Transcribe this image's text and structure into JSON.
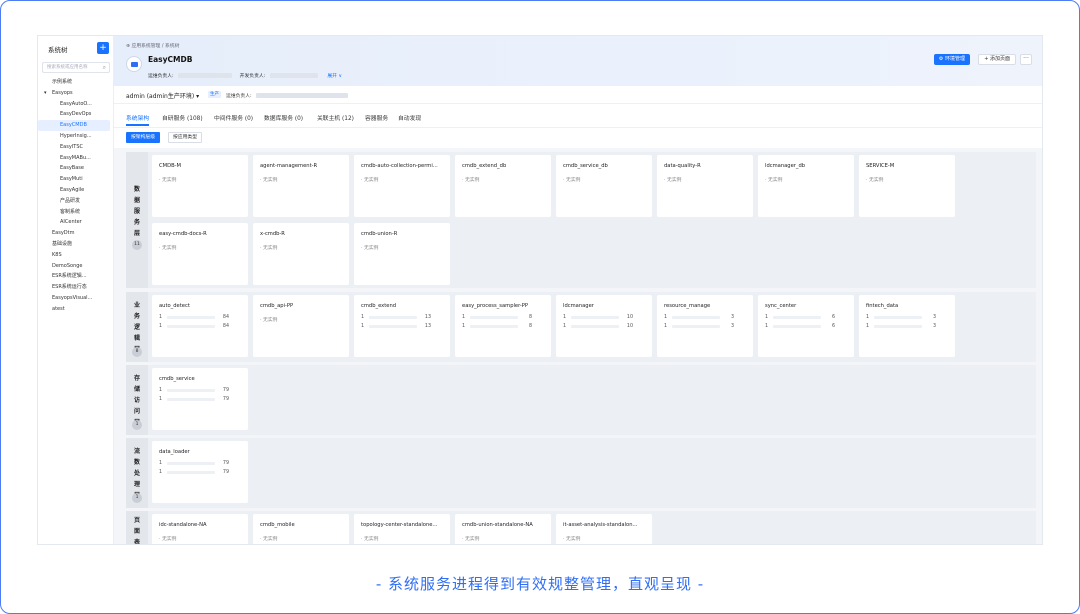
{
  "sidebar": {
    "title": "系统树",
    "add_label": "+",
    "search_placeholder": "搜索系统或应用名称",
    "items": [
      {
        "label": "示例系统",
        "indent": 1
      },
      {
        "label": "Easyops",
        "indent": 0,
        "caret": true
      },
      {
        "label": "EasyAutoO...",
        "indent": 2
      },
      {
        "label": "EasyDevOps",
        "indent": 2
      },
      {
        "label": "EasyCMDB",
        "indent": 2,
        "active": true
      },
      {
        "label": "HyperInsig...",
        "indent": 2
      },
      {
        "label": "EasyITSC",
        "indent": 2
      },
      {
        "label": "EasyMABu...",
        "indent": 2
      },
      {
        "label": "EasyBase",
        "indent": 2
      },
      {
        "label": "EasyMuti",
        "indent": 2
      },
      {
        "label": "EasyAgile",
        "indent": 2
      },
      {
        "label": "产品研发",
        "indent": 2
      },
      {
        "label": "客制系统",
        "indent": 2
      },
      {
        "label": "AICenter",
        "indent": 2
      },
      {
        "label": "EasyDtm",
        "indent": 0
      },
      {
        "label": "基础设施",
        "indent": 0
      },
      {
        "label": "K8S",
        "indent": 0
      },
      {
        "label": "DemoSonge",
        "indent": 0
      },
      {
        "label": "ESR系统逻辑...",
        "indent": 0
      },
      {
        "label": "ESR系统运行态",
        "indent": 0
      },
      {
        "label": "EasyopsVisual...",
        "indent": 0
      },
      {
        "label": "atest",
        "indent": 0
      }
    ]
  },
  "header": {
    "breadcrumb": "⊕ 应用系统管理 / 系统树",
    "app_name": "EasyCMDB",
    "ops_owner_label": "运维负责人:",
    "dev_owner_label": "开发负责人:",
    "expand_label": "展开 ∨",
    "env_button": "⚙ 环境管理",
    "add_page_button": "+ 添加页面",
    "more_button": "···"
  },
  "subheader": {
    "account": "admin (admin生产环境) ▾",
    "env_badge": "生产",
    "ops_label": "运维负责人:"
  },
  "tabs": [
    {
      "label": "系统架构",
      "active": true
    },
    {
      "label": "自研服务 (108)"
    },
    {
      "label": "中间件服务 (0)"
    },
    {
      "label": "数据库服务 (0)"
    },
    {
      "label": "关联主机 (12)"
    },
    {
      "label": "容器服务"
    },
    {
      "label": "自动发现"
    }
  ],
  "view_buttons": [
    {
      "label": "按架构层级",
      "active": true
    },
    {
      "label": "按应用类型"
    }
  ],
  "no_instance": "· 无实例",
  "layers": [
    {
      "name": "数\n据\n服\n务\n层",
      "count": "11",
      "cards": [
        {
          "name": "CMDB-M",
          "rows": []
        },
        {
          "name": "agent-management-R",
          "rows": []
        },
        {
          "name": "cmdb-auto-collection-permi...",
          "rows": []
        },
        {
          "name": "cmdb_extend_db",
          "rows": []
        },
        {
          "name": "cmdb_service_db",
          "rows": []
        },
        {
          "name": "data-quality-R",
          "rows": []
        },
        {
          "name": "ldcmanager_db",
          "rows": []
        },
        {
          "name": "SERVICE-M",
          "rows": []
        },
        {
          "name": "easy-cmdb-docs-R",
          "rows": []
        },
        {
          "name": "x-cmdb-R",
          "rows": []
        },
        {
          "name": "cmdb-union-R",
          "rows": []
        }
      ]
    },
    {
      "name": "业\n务\n逻\n辑\n层",
      "count": "8",
      "cards": [
        {
          "name": "auto_detect",
          "rows": [
            {
              "k": "1",
              "v": "84"
            },
            {
              "k": "1",
              "v": "84"
            }
          ]
        },
        {
          "name": "cmdb_api-PP",
          "rows": []
        },
        {
          "name": "cmdb_extend",
          "rows": [
            {
              "k": "1",
              "v": "13"
            },
            {
              "k": "1",
              "v": "13"
            }
          ]
        },
        {
          "name": "easy_process_sampler-PP",
          "rows": [
            {
              "k": "1",
              "v": "8"
            },
            {
              "k": "1",
              "v": "8"
            }
          ]
        },
        {
          "name": "ldcmanager",
          "rows": [
            {
              "k": "1",
              "v": "10"
            },
            {
              "k": "1",
              "v": "10"
            }
          ]
        },
        {
          "name": "resource_manage",
          "rows": [
            {
              "k": "1",
              "v": "3"
            },
            {
              "k": "1",
              "v": "3"
            }
          ]
        },
        {
          "name": "sync_center",
          "rows": [
            {
              "k": "1",
              "v": "6"
            },
            {
              "k": "1",
              "v": "6"
            }
          ]
        },
        {
          "name": "fintech_data",
          "rows": [
            {
              "k": "1",
              "v": "3"
            },
            {
              "k": "1",
              "v": "3"
            }
          ]
        }
      ]
    },
    {
      "name": "存\n储\n访\n问\n层",
      "count": "1",
      "cards": [
        {
          "name": "cmdb_service",
          "rows": [
            {
              "k": "1",
              "v": "79"
            },
            {
              "k": "1",
              "v": "79"
            }
          ]
        }
      ]
    },
    {
      "name": "流\n数\n处\n理\n层",
      "count": "1",
      "cards": [
        {
          "name": "data_loader",
          "rows": [
            {
              "k": "1",
              "v": "79"
            },
            {
              "k": "1",
              "v": "79"
            }
          ]
        }
      ]
    },
    {
      "name": "页\n面\n表\n示",
      "count": "",
      "cards": [
        {
          "name": "idc-standalone-NA",
          "rows": []
        },
        {
          "name": "cmdb_mobile",
          "rows": []
        },
        {
          "name": "topology-center-standalone...",
          "rows": []
        },
        {
          "name": "cmdb-union-standalone-NA",
          "rows": []
        },
        {
          "name": "it-asset-analysis-standalon...",
          "rows": []
        }
      ]
    }
  ],
  "caption": "- 系统服务进程得到有效规整管理，直观呈现 -"
}
